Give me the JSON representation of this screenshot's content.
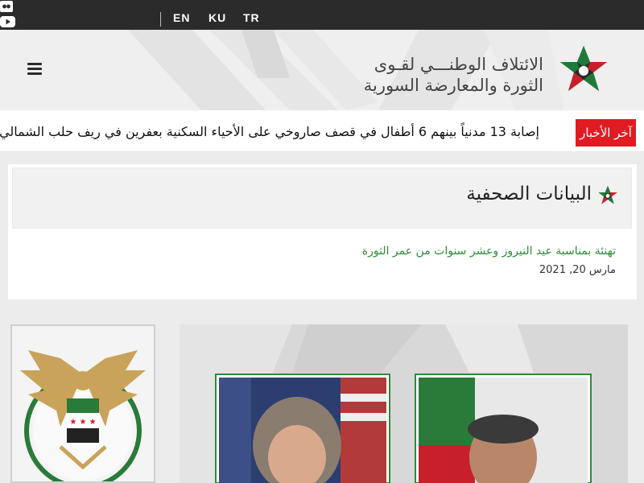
{
  "topbar": {
    "social_icons": [
      "flickr-icon",
      "youtube-icon",
      "instagram-icon",
      "twitter-icon",
      "facebook-icon"
    ],
    "languages": [
      "EN",
      "KU",
      "TR"
    ]
  },
  "header": {
    "logo_line1": "الائتلاف الوطنـــي لقـوى",
    "logo_line2": "الثورة والمعارضة السورية",
    "menu_icon": "hamburger-menu-icon"
  },
  "ticker": {
    "label": "آخر الأخبار",
    "headline": "إصابة 13 مدنياً بينهم 6 أطفال في قصف صاروخي على الأحياء السكنية بعفرين في ريف حلب الشمالي"
  },
  "press": {
    "title": "البيانات الصحفية",
    "article_title": "تهنئة بمناسبة عيد النيروز وعشر سنوات من عمر الثورة",
    "article_date": "مارس 20, 2021"
  },
  "colors": {
    "topbar": "#2b2b2b",
    "ticker_label": "#e11b22",
    "link_green": "#2e8b3a",
    "star_green": "#1f7a3a",
    "star_red": "#c8202a"
  }
}
